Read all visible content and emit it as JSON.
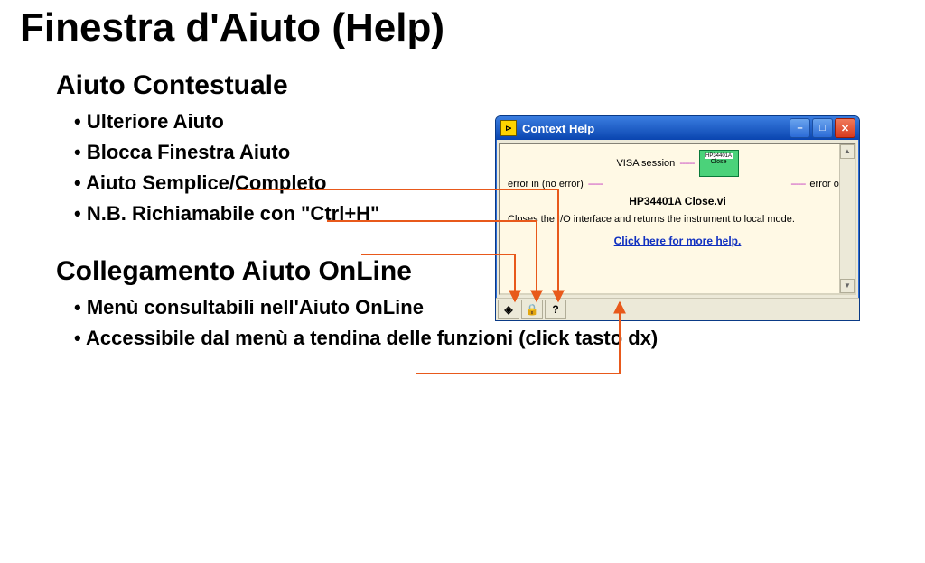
{
  "title": "Finestra d'Aiuto (Help)",
  "section1": {
    "heading": "Aiuto Contestuale",
    "bullets": [
      "Ulteriore Aiuto",
      "Blocca Finestra Aiuto",
      "Aiuto Semplice/Completo",
      "N.B. Richiamabile con \"Ctrl+H\""
    ]
  },
  "section2": {
    "heading": "Collegamento Aiuto OnLine",
    "bullets": [
      "Menù consultabili nell'Aiuto OnLine",
      "Accessibile dal menù a tendina delle funzioni (click tasto dx)"
    ]
  },
  "contextHelp": {
    "windowTitle": "Context Help",
    "appIconText": "⊳",
    "visaSessionLabel": "VISA session",
    "errorInLabel": "error in (no error)",
    "errorOutLabel": "error out",
    "viIconTop": "HP34401A",
    "viIconBottom": "Close",
    "viName": "HP34401A Close.vi",
    "description": "Closes the I/O interface and returns the instrument to local mode.",
    "helpLink": "Click here for more help.",
    "toolbar": {
      "simpleCompleteIcon": "◈",
      "lockIcon": "🔒",
      "questionIcon": "?"
    }
  }
}
